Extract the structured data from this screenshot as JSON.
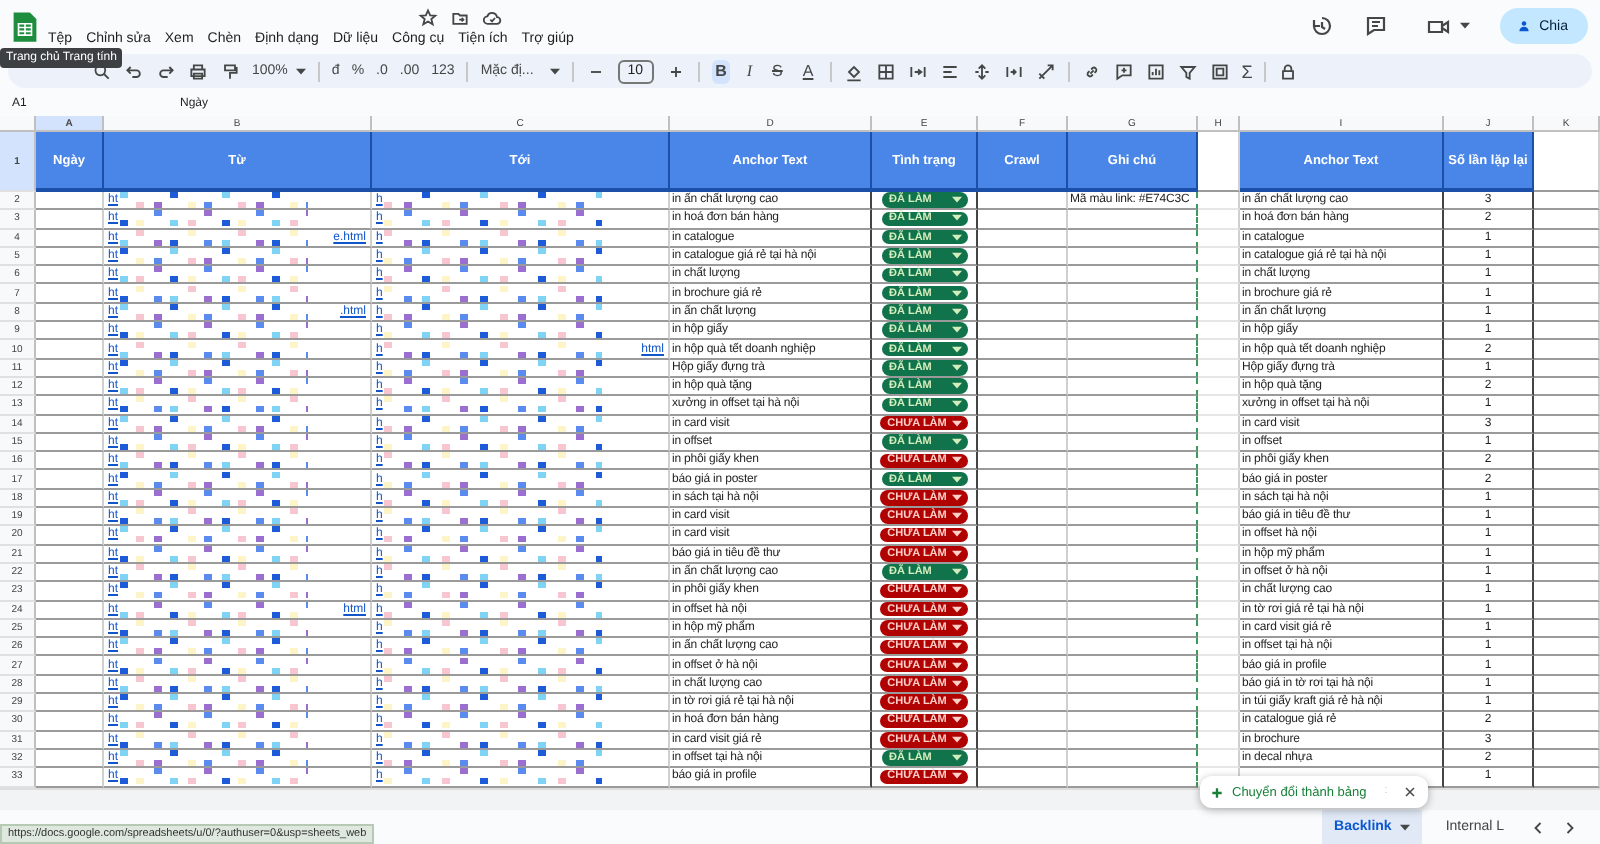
{
  "app": {
    "tooltip": "Trang chủ Trang tính",
    "menu": [
      "Tệp",
      "Chỉnh sửa",
      "Xem",
      "Chèn",
      "Định dạng",
      "Dữ liệu",
      "Công cụ",
      "Tiện ích",
      "Trợ giúp"
    ],
    "share_button": "Chia"
  },
  "toolbar": {
    "zoom": "100%",
    "number_formats": [
      "đ",
      "%",
      ".0",
      ".00",
      "123"
    ],
    "font": "Mặc đị...",
    "font_size": "10",
    "format_buttons": [
      {
        "label": "B",
        "selected": true
      },
      {
        "label": "I",
        "selected": false
      },
      {
        "label": "S",
        "selected": false
      },
      {
        "label": "A",
        "selected": false
      }
    ],
    "functions": "Σ"
  },
  "formula_bar": {
    "cell": "A1",
    "value": "Ngày"
  },
  "columns": [
    {
      "label": "A",
      "selected": true
    },
    {
      "label": "B",
      "selected": false
    },
    {
      "label": "C",
      "selected": false
    },
    {
      "label": "D",
      "selected": false
    },
    {
      "label": "E",
      "selected": false
    },
    {
      "label": "F",
      "selected": false
    },
    {
      "label": "G",
      "selected": false
    },
    {
      "label": "H",
      "selected": false
    },
    {
      "label": "I",
      "selected": false
    },
    {
      "label": "J",
      "selected": false
    },
    {
      "label": "K",
      "selected": false
    }
  ],
  "sheet": {
    "header_row": "1",
    "headers": [
      "Ngày",
      "Từ",
      "Tới",
      "Anchor Text",
      "Tình trạng",
      "Crawl",
      "Ghi chú",
      "Anchor Text",
      "Số lần lặp lại"
    ],
    "rows": [
      {
        "num": "2",
        "from": "ht",
        "to": "h",
        "anchor": "in ấn chất lượng cao",
        "status": "ĐÃ LÀM",
        "done": true,
        "note": "Mã màu link: #E74C3C",
        "anchor2": "in ấn chất lượng cao",
        "count": "3"
      },
      {
        "num": "3",
        "from": "ht",
        "to": "h",
        "anchor": "in hoá đơn bán hàng",
        "status": "ĐÃ LÀM",
        "done": true,
        "anchor2": "in hoá đơn bán hàng",
        "count": "2"
      },
      {
        "num": "4",
        "from": "ht",
        "from_tail": "e.html",
        "to": "h",
        "anchor": "in catalogue",
        "status": "ĐÃ LÀM",
        "done": true,
        "anchor2": "in catalogue",
        "count": "1"
      },
      {
        "num": "5",
        "from": "ht",
        "to": "h",
        "anchor": "in catalogue giá rẻ tại hà nội",
        "status": "ĐÃ LÀM",
        "done": true,
        "anchor2": "in catalogue giá rẻ tại hà nội",
        "count": "1"
      },
      {
        "num": "6",
        "from": "ht",
        "to": "h",
        "anchor": "in chất lượng",
        "status": "ĐÃ LÀM",
        "done": true,
        "anchor2": "in chất lượng",
        "count": "1"
      },
      {
        "num": "7",
        "from": "ht",
        "to": "h",
        "anchor": "in brochure giá rẻ",
        "status": "ĐÃ LÀM",
        "done": true,
        "anchor2": "in brochure giá rẻ",
        "count": "1"
      },
      {
        "num": "8",
        "from": "ht",
        "from_tail": ".html",
        "to": "h",
        "anchor": "in ấn chất lượng",
        "status": "ĐÃ LÀM",
        "done": true,
        "anchor2": "in ấn chất lượng",
        "count": "1"
      },
      {
        "num": "9",
        "from": "ht",
        "to": "h",
        "anchor": "in hộp giấy",
        "status": "ĐÃ LÀM",
        "done": true,
        "anchor2": "in hộp giấy",
        "count": "1"
      },
      {
        "num": "10",
        "from": "ht",
        "to": "h",
        "to_tail": "html",
        "anchor": "in hộp quà tết doanh nghiệp",
        "status": "ĐÃ LÀM",
        "done": true,
        "anchor2": "in hộp quà tết doanh nghiệp",
        "count": "2"
      },
      {
        "num": "11",
        "from": "ht",
        "to": "h",
        "anchor": "Hộp giấy đựng trà",
        "status": "ĐÃ LÀM",
        "done": true,
        "anchor2": "Hộp giấy đựng trà",
        "count": "1"
      },
      {
        "num": "12",
        "from": "ht",
        "to": "h",
        "anchor": "in hộp quà tặng",
        "status": "ĐÃ LÀM",
        "done": true,
        "anchor2": "in hộp quà tặng",
        "count": "2"
      },
      {
        "num": "13",
        "from": "ht",
        "to": "h",
        "anchor": "xưởng in offset tại hà nội",
        "status": "ĐÃ LÀM",
        "done": true,
        "anchor2": "xưởng in offset tại hà nội",
        "count": "1"
      },
      {
        "num": "14",
        "from": "ht",
        "to": "h",
        "anchor": "in card visit",
        "status": "CHƯA LÀM",
        "done": false,
        "anchor2": "in card visit",
        "count": "3"
      },
      {
        "num": "15",
        "from": "ht",
        "to": "h",
        "anchor": "in offset",
        "status": "ĐÃ LÀM",
        "done": true,
        "anchor2": "in offset",
        "count": "1"
      },
      {
        "num": "16",
        "from": "ht",
        "to": "h",
        "anchor": "in phôi giấy khen",
        "status": "CHƯA LÀM",
        "done": false,
        "anchor2": "in phôi giấy khen",
        "count": "2"
      },
      {
        "num": "17",
        "from": "ht",
        "to": "h",
        "anchor": "báo giá in poster",
        "status": "ĐÃ LÀM",
        "done": true,
        "anchor2": "báo giá in poster",
        "count": "2"
      },
      {
        "num": "18",
        "from": "ht",
        "to": "h",
        "anchor": "in sách tại hà nội",
        "status": "CHƯA LÀM",
        "done": false,
        "anchor2": "in sách tại hà nội",
        "count": "1"
      },
      {
        "num": "19",
        "from": "ht",
        "to": "h",
        "anchor": "in card visit",
        "status": "CHƯA LÀM",
        "done": false,
        "anchor2": "báo giá in tiêu đề thư",
        "count": "1"
      },
      {
        "num": "20",
        "from": "ht",
        "to": "h",
        "anchor": "in card visit",
        "status": "CHƯA LÀM",
        "done": false,
        "anchor2": "in offset hà nội",
        "count": "1"
      },
      {
        "num": "21",
        "from": "ht",
        "to": "h",
        "anchor": "báo giá in tiêu đề thư",
        "status": "CHƯA LÀM",
        "done": false,
        "anchor2": "in hộp mỹ phẩm",
        "count": "1"
      },
      {
        "num": "22",
        "from": "ht",
        "to": "h",
        "anchor": "in ấn chất lượng cao",
        "status": "ĐÃ LÀM",
        "done": true,
        "anchor2": "in offset ở hà nội",
        "count": "1"
      },
      {
        "num": "23",
        "from": "ht",
        "to": "h",
        "anchor": "in phôi giấy khen",
        "status": "CHƯA LÀM",
        "done": false,
        "anchor2": "in chất lượng cao",
        "count": "1"
      },
      {
        "num": "24",
        "from": "ht",
        "from_tail": "html",
        "to": "h",
        "anchor": "in offset hà nội",
        "status": "CHƯA LÀM",
        "done": false,
        "anchor2": "in tờ rơi giá rẻ tại hà nội",
        "count": "1"
      },
      {
        "num": "25",
        "from": "ht",
        "to": "h",
        "anchor": "in hộp mỹ phẩm",
        "status": "CHƯA LÀM",
        "done": false,
        "anchor2": "in card visit giá rẻ",
        "count": "1"
      },
      {
        "num": "26",
        "from": "ht",
        "to": "h",
        "anchor": "in ấn chất lượng cao",
        "status": "CHƯA LÀM",
        "done": false,
        "anchor2": "in offset tại hà nội",
        "count": "1"
      },
      {
        "num": "27",
        "from": "ht",
        "to": "h",
        "anchor": "in offset ở hà nội",
        "status": "CHƯA LÀM",
        "done": false,
        "anchor2": "báo giá in profile",
        "count": "1"
      },
      {
        "num": "28",
        "from": "ht",
        "to": "h",
        "anchor": "in chất lượng cao",
        "status": "CHƯA LÀM",
        "done": false,
        "anchor2": "báo giá in tờ rơi tại hà nội",
        "count": "1"
      },
      {
        "num": "29",
        "from": "ht",
        "to": "h",
        "anchor": "in tờ rơi giá rẻ tại hà nội",
        "status": "CHƯA LÀM",
        "done": false,
        "anchor2": "in túi giấy kraft giá rẻ hà nội",
        "count": "1"
      },
      {
        "num": "30",
        "from": "ht",
        "to": "h",
        "anchor": "in hoá đơn bán hàng",
        "status": "CHƯA LÀM",
        "done": false,
        "anchor2": "in catalogue giá rẻ",
        "count": "2"
      },
      {
        "num": "31",
        "from": "ht",
        "to": "h",
        "anchor": "in card visit giá rẻ",
        "status": "CHƯA LÀM",
        "done": false,
        "anchor2": "in brochure",
        "count": "3"
      },
      {
        "num": "32",
        "from": "ht",
        "to": "h",
        "anchor": "in offset tại hà nội",
        "status": "ĐÃ LÀM",
        "done": true,
        "anchor2": "in decal nhựa",
        "count": "2"
      },
      {
        "num": "33",
        "from": "ht",
        "to": "h",
        "anchor": "báo giá in profile",
        "status": "CHƯA LÀM",
        "done": false,
        "count": "1"
      }
    ]
  },
  "popup": {
    "label": "Chuyển đổi thành bảng"
  },
  "status_url": "https://docs.google.com/spreadsheets/u/0/?authuser=0&usp=sheets_web",
  "sheet_tabs": [
    {
      "label": "Backlink",
      "selected": true
    },
    {
      "label": "Internal L",
      "selected": false
    }
  ]
}
